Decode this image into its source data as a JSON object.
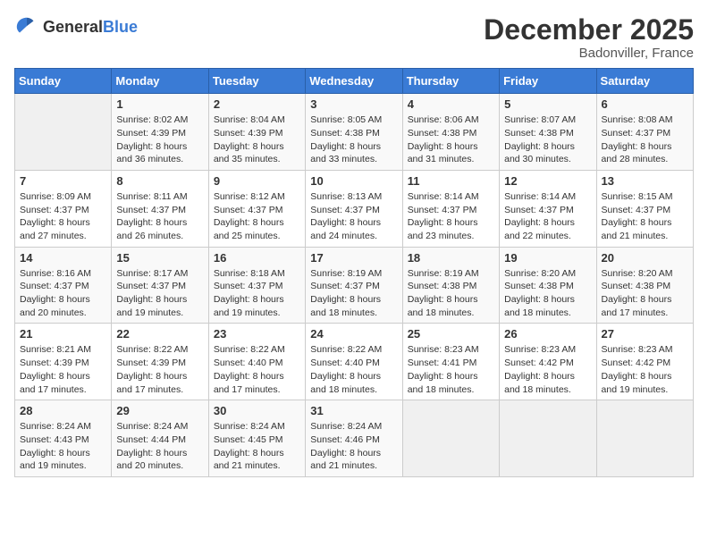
{
  "header": {
    "logo_general": "General",
    "logo_blue": "Blue",
    "month": "December 2025",
    "location": "Badonviller, France"
  },
  "days_of_week": [
    "Sunday",
    "Monday",
    "Tuesday",
    "Wednesday",
    "Thursday",
    "Friday",
    "Saturday"
  ],
  "weeks": [
    [
      {
        "day": "",
        "sunrise": "",
        "sunset": "",
        "daylight": "",
        "empty": true
      },
      {
        "day": "1",
        "sunrise": "Sunrise: 8:02 AM",
        "sunset": "Sunset: 4:39 PM",
        "daylight": "Daylight: 8 hours and 36 minutes."
      },
      {
        "day": "2",
        "sunrise": "Sunrise: 8:04 AM",
        "sunset": "Sunset: 4:39 PM",
        "daylight": "Daylight: 8 hours and 35 minutes."
      },
      {
        "day": "3",
        "sunrise": "Sunrise: 8:05 AM",
        "sunset": "Sunset: 4:38 PM",
        "daylight": "Daylight: 8 hours and 33 minutes."
      },
      {
        "day": "4",
        "sunrise": "Sunrise: 8:06 AM",
        "sunset": "Sunset: 4:38 PM",
        "daylight": "Daylight: 8 hours and 31 minutes."
      },
      {
        "day": "5",
        "sunrise": "Sunrise: 8:07 AM",
        "sunset": "Sunset: 4:38 PM",
        "daylight": "Daylight: 8 hours and 30 minutes."
      },
      {
        "day": "6",
        "sunrise": "Sunrise: 8:08 AM",
        "sunset": "Sunset: 4:37 PM",
        "daylight": "Daylight: 8 hours and 28 minutes."
      }
    ],
    [
      {
        "day": "7",
        "sunrise": "Sunrise: 8:09 AM",
        "sunset": "Sunset: 4:37 PM",
        "daylight": "Daylight: 8 hours and 27 minutes."
      },
      {
        "day": "8",
        "sunrise": "Sunrise: 8:11 AM",
        "sunset": "Sunset: 4:37 PM",
        "daylight": "Daylight: 8 hours and 26 minutes."
      },
      {
        "day": "9",
        "sunrise": "Sunrise: 8:12 AM",
        "sunset": "Sunset: 4:37 PM",
        "daylight": "Daylight: 8 hours and 25 minutes."
      },
      {
        "day": "10",
        "sunrise": "Sunrise: 8:13 AM",
        "sunset": "Sunset: 4:37 PM",
        "daylight": "Daylight: 8 hours and 24 minutes."
      },
      {
        "day": "11",
        "sunrise": "Sunrise: 8:14 AM",
        "sunset": "Sunset: 4:37 PM",
        "daylight": "Daylight: 8 hours and 23 minutes."
      },
      {
        "day": "12",
        "sunrise": "Sunrise: 8:14 AM",
        "sunset": "Sunset: 4:37 PM",
        "daylight": "Daylight: 8 hours and 22 minutes."
      },
      {
        "day": "13",
        "sunrise": "Sunrise: 8:15 AM",
        "sunset": "Sunset: 4:37 PM",
        "daylight": "Daylight: 8 hours and 21 minutes."
      }
    ],
    [
      {
        "day": "14",
        "sunrise": "Sunrise: 8:16 AM",
        "sunset": "Sunset: 4:37 PM",
        "daylight": "Daylight: 8 hours and 20 minutes."
      },
      {
        "day": "15",
        "sunrise": "Sunrise: 8:17 AM",
        "sunset": "Sunset: 4:37 PM",
        "daylight": "Daylight: 8 hours and 19 minutes."
      },
      {
        "day": "16",
        "sunrise": "Sunrise: 8:18 AM",
        "sunset": "Sunset: 4:37 PM",
        "daylight": "Daylight: 8 hours and 19 minutes."
      },
      {
        "day": "17",
        "sunrise": "Sunrise: 8:19 AM",
        "sunset": "Sunset: 4:37 PM",
        "daylight": "Daylight: 8 hours and 18 minutes."
      },
      {
        "day": "18",
        "sunrise": "Sunrise: 8:19 AM",
        "sunset": "Sunset: 4:38 PM",
        "daylight": "Daylight: 8 hours and 18 minutes."
      },
      {
        "day": "19",
        "sunrise": "Sunrise: 8:20 AM",
        "sunset": "Sunset: 4:38 PM",
        "daylight": "Daylight: 8 hours and 18 minutes."
      },
      {
        "day": "20",
        "sunrise": "Sunrise: 8:20 AM",
        "sunset": "Sunset: 4:38 PM",
        "daylight": "Daylight: 8 hours and 17 minutes."
      }
    ],
    [
      {
        "day": "21",
        "sunrise": "Sunrise: 8:21 AM",
        "sunset": "Sunset: 4:39 PM",
        "daylight": "Daylight: 8 hours and 17 minutes."
      },
      {
        "day": "22",
        "sunrise": "Sunrise: 8:22 AM",
        "sunset": "Sunset: 4:39 PM",
        "daylight": "Daylight: 8 hours and 17 minutes."
      },
      {
        "day": "23",
        "sunrise": "Sunrise: 8:22 AM",
        "sunset": "Sunset: 4:40 PM",
        "daylight": "Daylight: 8 hours and 17 minutes."
      },
      {
        "day": "24",
        "sunrise": "Sunrise: 8:22 AM",
        "sunset": "Sunset: 4:40 PM",
        "daylight": "Daylight: 8 hours and 18 minutes."
      },
      {
        "day": "25",
        "sunrise": "Sunrise: 8:23 AM",
        "sunset": "Sunset: 4:41 PM",
        "daylight": "Daylight: 8 hours and 18 minutes."
      },
      {
        "day": "26",
        "sunrise": "Sunrise: 8:23 AM",
        "sunset": "Sunset: 4:42 PM",
        "daylight": "Daylight: 8 hours and 18 minutes."
      },
      {
        "day": "27",
        "sunrise": "Sunrise: 8:23 AM",
        "sunset": "Sunset: 4:42 PM",
        "daylight": "Daylight: 8 hours and 19 minutes."
      }
    ],
    [
      {
        "day": "28",
        "sunrise": "Sunrise: 8:24 AM",
        "sunset": "Sunset: 4:43 PM",
        "daylight": "Daylight: 8 hours and 19 minutes."
      },
      {
        "day": "29",
        "sunrise": "Sunrise: 8:24 AM",
        "sunset": "Sunset: 4:44 PM",
        "daylight": "Daylight: 8 hours and 20 minutes."
      },
      {
        "day": "30",
        "sunrise": "Sunrise: 8:24 AM",
        "sunset": "Sunset: 4:45 PM",
        "daylight": "Daylight: 8 hours and 21 minutes."
      },
      {
        "day": "31",
        "sunrise": "Sunrise: 8:24 AM",
        "sunset": "Sunset: 4:46 PM",
        "daylight": "Daylight: 8 hours and 21 minutes."
      },
      {
        "day": "",
        "sunrise": "",
        "sunset": "",
        "daylight": "",
        "empty": true
      },
      {
        "day": "",
        "sunrise": "",
        "sunset": "",
        "daylight": "",
        "empty": true
      },
      {
        "day": "",
        "sunrise": "",
        "sunset": "",
        "daylight": "",
        "empty": true
      }
    ]
  ]
}
